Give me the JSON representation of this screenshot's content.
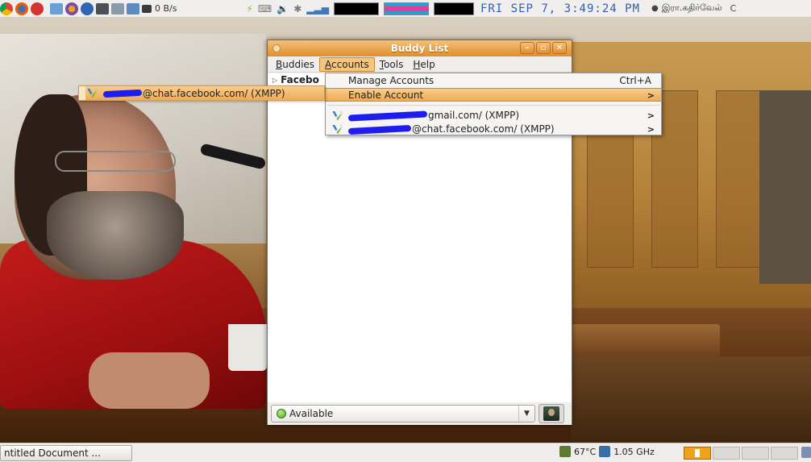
{
  "top_panel": {
    "net_speed": "0 B/s",
    "clock": "FRI SEP  7,  3:49:24 PM",
    "user": "இரா.கதிர்வேல்",
    "end_glyph": "C"
  },
  "window": {
    "title": "Buddy List",
    "menus": [
      {
        "label": "Buddies",
        "key": "B",
        "rest": "uddies"
      },
      {
        "label": "Accounts",
        "key": "A",
        "rest": "ccounts"
      },
      {
        "label": "Tools",
        "key": "T",
        "rest": "ools"
      },
      {
        "label": "Help",
        "key": "H",
        "rest": "elp"
      }
    ],
    "group_label": "Facebo",
    "status": "Available"
  },
  "accounts_menu": {
    "manage_label": "Manage Accounts",
    "manage_accel": "Ctrl+A",
    "enable_label": "Enable Account",
    "accounts": [
      {
        "suffix": "gmail.com/ (XMPP)"
      },
      {
        "suffix": "@chat.facebook.com/ (XMPP)"
      }
    ]
  },
  "submenu": {
    "suffix": "@chat.facebook.com/ (XMPP)"
  },
  "bottom_panel": {
    "task": "ntitled Document ...",
    "temp": "67°C",
    "cpu": "1.05 GHz"
  },
  "colors": {
    "highlight": "#eeac55",
    "clock": "#2f5fb7",
    "redaction": "#1d1df0"
  }
}
